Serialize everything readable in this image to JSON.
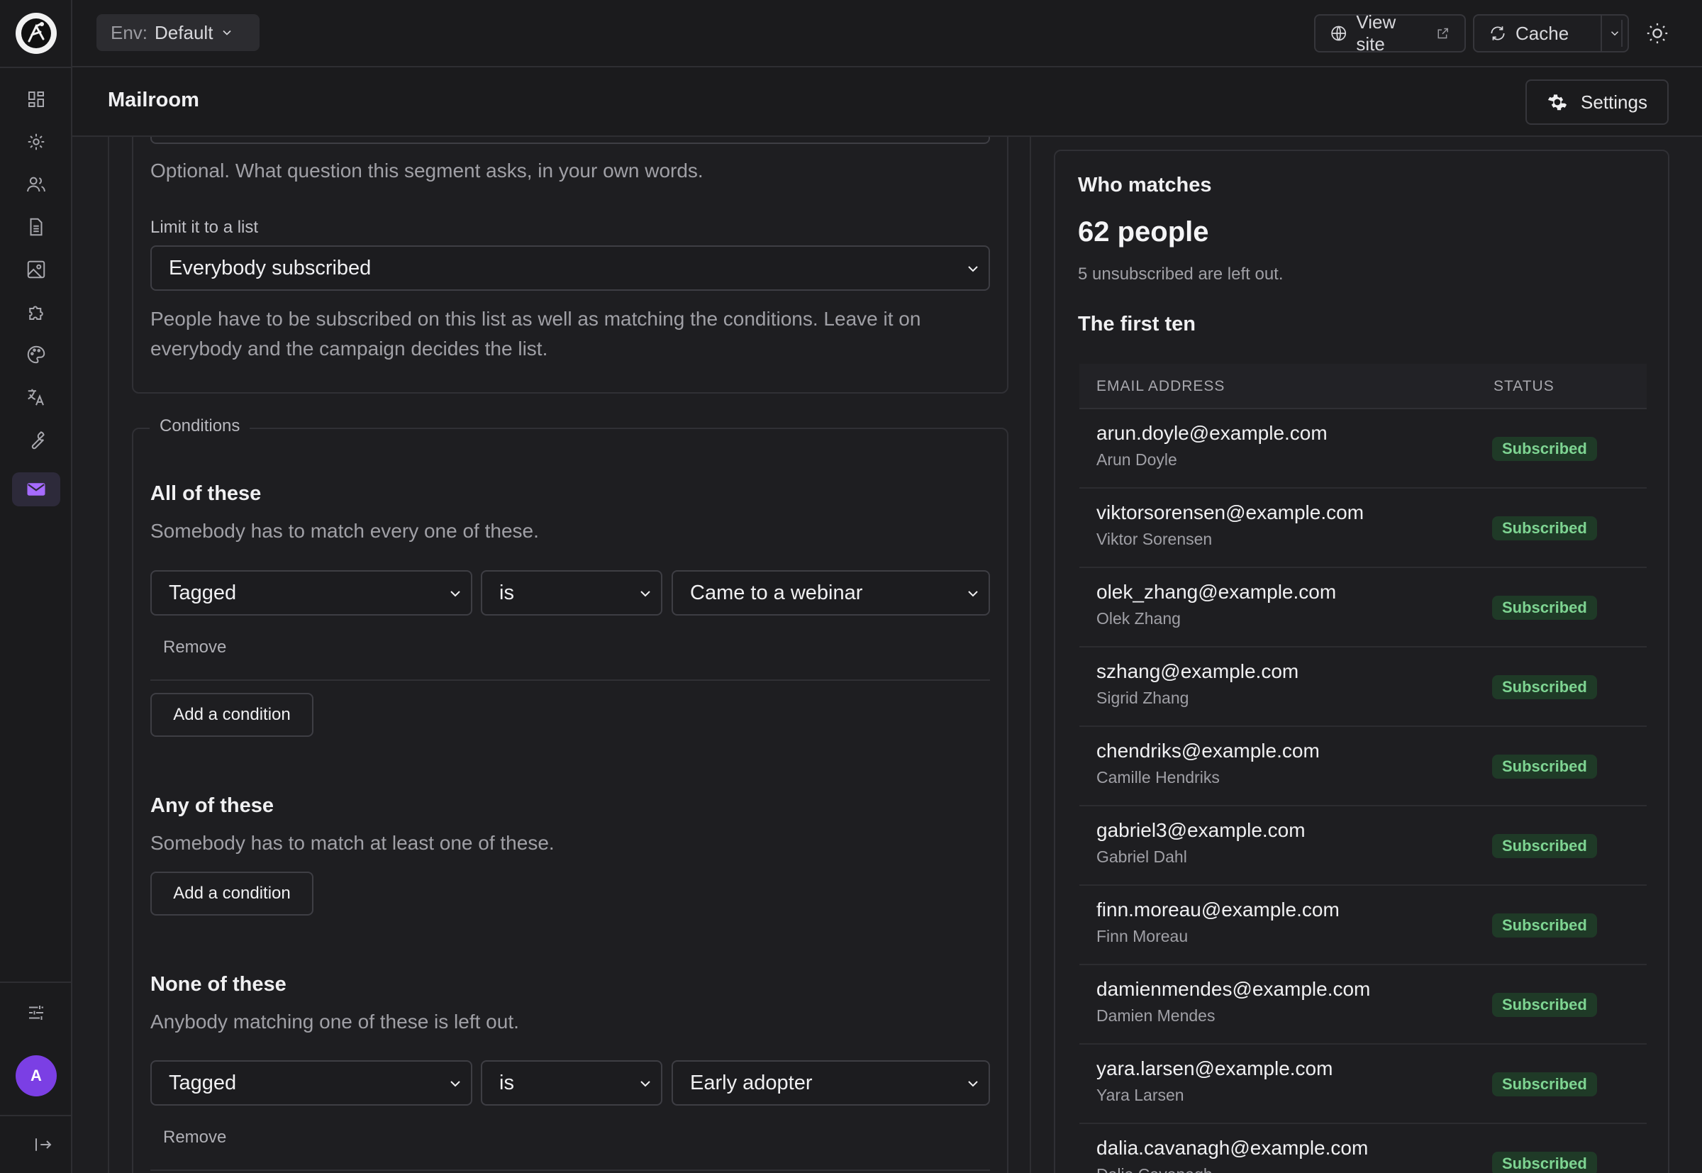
{
  "topbar": {
    "env_label": "Env:",
    "env_value": "Default",
    "view_site": "View site",
    "cache": "Cache"
  },
  "page": {
    "title": "Mailroom",
    "settings_label": "Settings"
  },
  "sidebar": {
    "items": [
      {
        "icon": "dashboard-icon"
      },
      {
        "icon": "gear-icon"
      },
      {
        "icon": "users-icon"
      },
      {
        "icon": "document-icon"
      },
      {
        "icon": "image-icon"
      },
      {
        "icon": "puzzle-icon"
      },
      {
        "icon": "palette-icon"
      },
      {
        "icon": "translate-icon"
      },
      {
        "icon": "wrench-icon"
      },
      {
        "icon": "mail-icon",
        "active": true
      }
    ],
    "avatar_letter": "A",
    "accent": "#7b3fe4"
  },
  "form": {
    "question_hint": "Optional. What question this segment asks, in your own words.",
    "list_label": "Limit it to a list",
    "list_value": "Everybody subscribed",
    "list_help": "People have to be subscribed on this list as well as matching the conditions. Leave it on everybody and the campaign decides the list.",
    "conditions_legend": "Conditions",
    "all": {
      "title": "All of these",
      "desc": "Somebody has to match every one of these.",
      "field": "Tagged",
      "op": "is",
      "value": "Came to a webinar",
      "remove": "Remove",
      "add": "Add a condition"
    },
    "any": {
      "title": "Any of these",
      "desc": "Somebody has to match at least one of these.",
      "add": "Add a condition"
    },
    "none": {
      "title": "None of these",
      "desc": "Anybody matching one of these is left out.",
      "field": "Tagged",
      "op": "is",
      "value": "Early adopter",
      "remove": "Remove"
    }
  },
  "matches": {
    "title": "Who matches",
    "count": "62 people",
    "note": "5 unsubscribed are left out.",
    "first_ten": "The first ten",
    "col_email": "EMAIL ADDRESS",
    "col_status": "STATUS",
    "rows": [
      {
        "email": "arun.doyle@example.com",
        "name": "Arun Doyle",
        "status": "Subscribed"
      },
      {
        "email": "viktorsorensen@example.com",
        "name": "Viktor Sorensen",
        "status": "Subscribed"
      },
      {
        "email": "olek_zhang@example.com",
        "name": "Olek Zhang",
        "status": "Subscribed"
      },
      {
        "email": "szhang@example.com",
        "name": "Sigrid Zhang",
        "status": "Subscribed"
      },
      {
        "email": "chendriks@example.com",
        "name": "Camille Hendriks",
        "status": "Subscribed"
      },
      {
        "email": "gabriel3@example.com",
        "name": "Gabriel Dahl",
        "status": "Subscribed"
      },
      {
        "email": "finn.moreau@example.com",
        "name": "Finn Moreau",
        "status": "Subscribed"
      },
      {
        "email": "damienmendes@example.com",
        "name": "Damien Mendes",
        "status": "Subscribed"
      },
      {
        "email": "yara.larsen@example.com",
        "name": "Yara Larsen",
        "status": "Subscribed"
      },
      {
        "email": "dalia.cavanagh@example.com",
        "name": "Dalia Cavanagh",
        "status": "Subscribed"
      }
    ]
  }
}
